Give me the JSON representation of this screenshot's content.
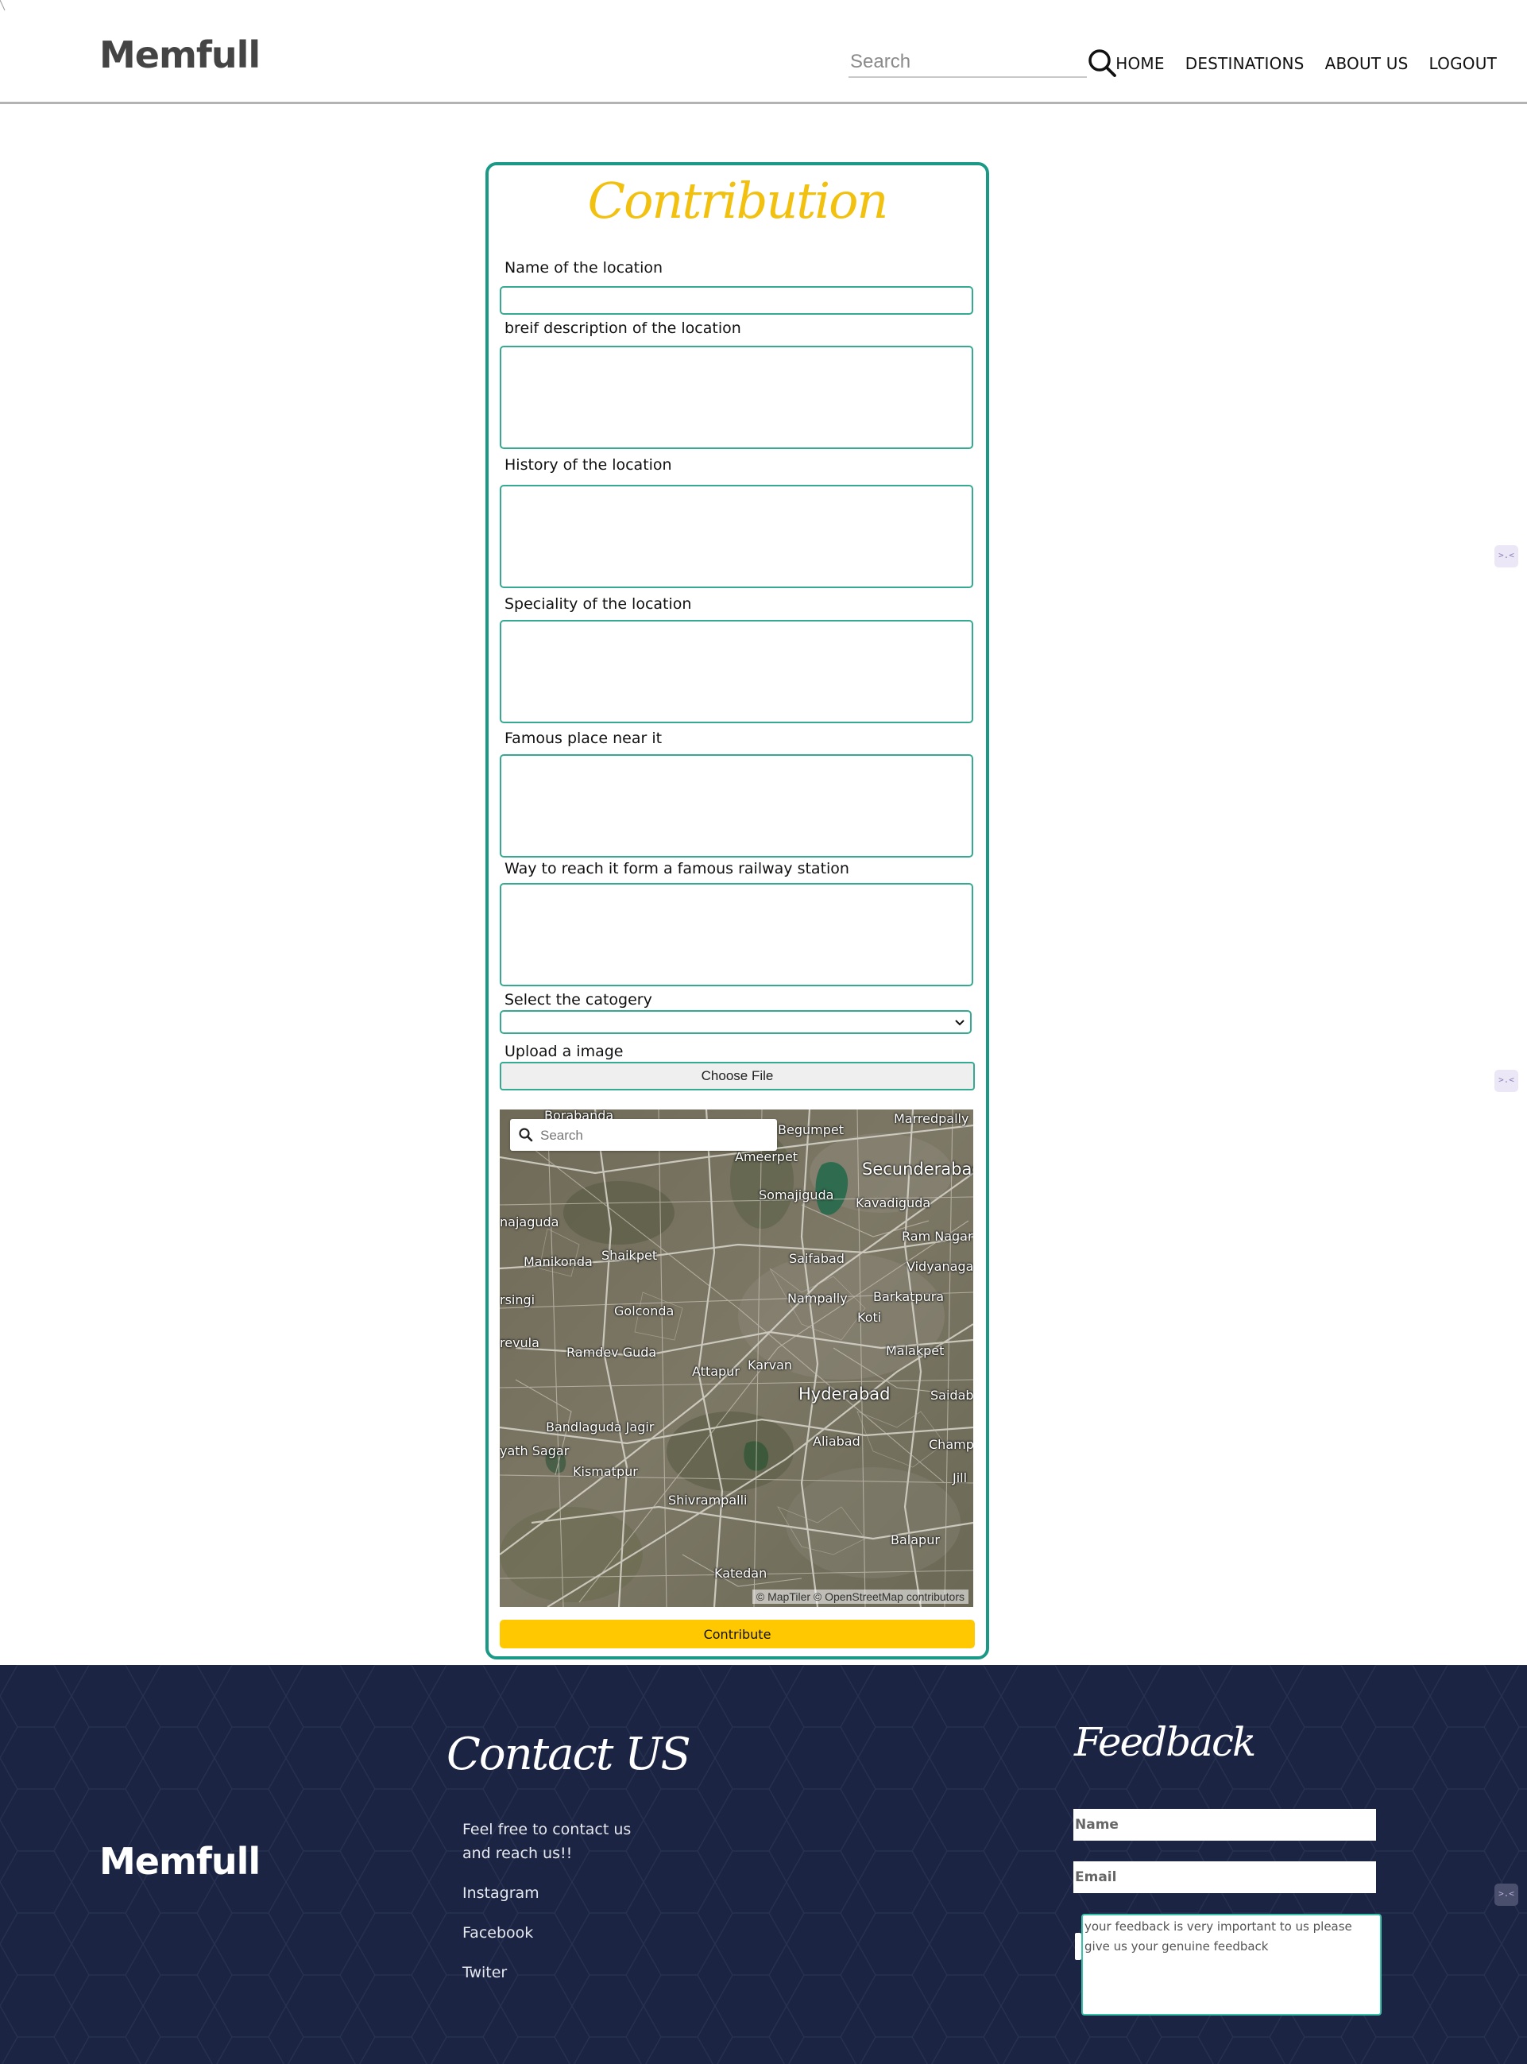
{
  "header": {
    "logo": "Memfull",
    "search_placeholder": "Search",
    "nav": [
      "HOME",
      "DESTINATIONS",
      "ABOUT US",
      "LOGOUT"
    ]
  },
  "form": {
    "title": "Contribution",
    "fields": {
      "name_label": "Name of the location",
      "description_label": "breif description of the location",
      "history_label": "History of the location",
      "speciality_label": "Speciality of the location",
      "famous_place_label": "Famous place near it",
      "way_label": "Way to reach it form a famous railway station",
      "category_label": "Select the catogery",
      "upload_label": "Upload a image"
    },
    "category_selected": "",
    "choose_file_label": "Choose File",
    "submit_label": "Contribute"
  },
  "map": {
    "search_placeholder": "Search",
    "attribution": "© MapTiler © OpenStreetMap contributors",
    "places": [
      {
        "name": "Borabanda",
        "size": "normal"
      },
      {
        "name": "Begumpet",
        "size": "normal"
      },
      {
        "name": "Marredpally",
        "size": "normal"
      },
      {
        "name": "Ameerpet",
        "size": "normal"
      },
      {
        "name": "Secunderabad",
        "size": "big"
      },
      {
        "name": "Somajiguda",
        "size": "normal"
      },
      {
        "name": "Kavadiguda",
        "size": "normal"
      },
      {
        "name": "najaguda",
        "size": "normal"
      },
      {
        "name": "Ram Nagar",
        "size": "normal"
      },
      {
        "name": "Manikonda",
        "size": "normal"
      },
      {
        "name": "Shaikpet",
        "size": "normal"
      },
      {
        "name": "Saifabad",
        "size": "normal"
      },
      {
        "name": "Vidyanagar",
        "size": "normal"
      },
      {
        "name": "Nampally",
        "size": "normal"
      },
      {
        "name": "Barkatpura",
        "size": "normal"
      },
      {
        "name": "rsingi",
        "size": "normal"
      },
      {
        "name": "Golconda",
        "size": "normal"
      },
      {
        "name": "Koti",
        "size": "normal"
      },
      {
        "name": "revula",
        "size": "normal"
      },
      {
        "name": "Ramdev Guda",
        "size": "normal"
      },
      {
        "name": "Malakpet",
        "size": "normal"
      },
      {
        "name": "Karvan",
        "size": "normal"
      },
      {
        "name": "Attapur",
        "size": "normal"
      },
      {
        "name": "Hyderabad",
        "size": "big"
      },
      {
        "name": "Saidab",
        "size": "normal"
      },
      {
        "name": "Bandlaguda Jagir",
        "size": "normal"
      },
      {
        "name": "Aliabad",
        "size": "normal"
      },
      {
        "name": "Champ",
        "size": "normal"
      },
      {
        "name": "yath Sagar",
        "size": "normal"
      },
      {
        "name": "Kismatpur",
        "size": "normal"
      },
      {
        "name": "Jill",
        "size": "normal"
      },
      {
        "name": "Shivrampalli",
        "size": "normal"
      },
      {
        "name": "Balapur",
        "size": "normal"
      },
      {
        "name": "Katedan",
        "size": "normal"
      }
    ]
  },
  "footer": {
    "logo": "Memfull",
    "contact_title": "Contact US",
    "contact_text_line1": "Feel free to contact us",
    "contact_text_line2": "and reach us!!",
    "links": [
      "Instagram",
      "Facebook",
      "Twiter"
    ],
    "feedback_title": "Feedback",
    "name_placeholder": "Name",
    "email_placeholder": "Email",
    "feedback_placeholder": "your feedback is very important to us please give us your genuine feedback"
  },
  "colors": {
    "accent_teal": "#1a9a86",
    "title_yellow": "#f2c110",
    "button_yellow": "#ffc800",
    "footer_navy": "#1b2442"
  }
}
